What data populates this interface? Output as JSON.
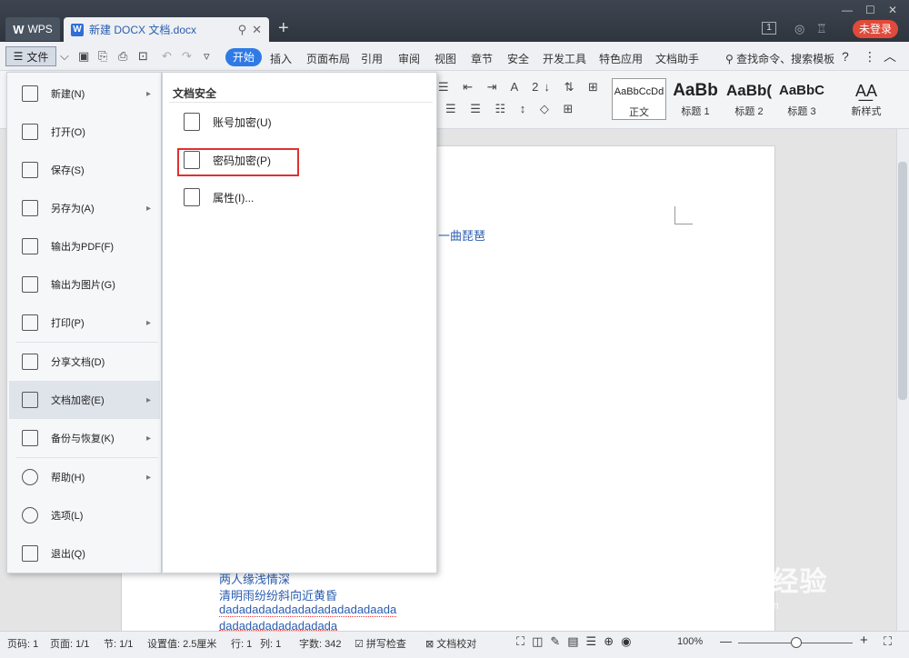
{
  "window": {
    "app_tab": "WPS",
    "doc_tab_title": "新建 DOCX 文档.docx",
    "new_tab_symbol": "+",
    "login_label": "未登录",
    "page_badge": "1"
  },
  "menubar": {
    "file_label": "文件",
    "start_label": "开始",
    "items": [
      "插入",
      "页面布局",
      "引用",
      "审阅",
      "视图",
      "章节",
      "安全",
      "开发工具",
      "特色应用",
      "文档助手"
    ],
    "search_label": "查找命令、搜索模板",
    "help_symbol": "?"
  },
  "ribbon": {
    "styles": [
      {
        "sample": "AaBbCcDd",
        "label": "正文"
      },
      {
        "sample": "AaBb",
        "label": "标题 1"
      },
      {
        "sample": "AaBb(",
        "label": "标题 2"
      },
      {
        "sample": "AaBbC",
        "label": "标题 3"
      }
    ],
    "new_style_label": "新样式"
  },
  "file_menu": {
    "items": [
      {
        "label": "新建(N)",
        "icon": "new-doc-icon",
        "submenu": true
      },
      {
        "label": "打开(O)",
        "icon": "folder-open-icon",
        "submenu": false
      },
      {
        "label": "保存(S)",
        "icon": "save-icon",
        "submenu": false
      },
      {
        "label": "另存为(A)",
        "icon": "save-as-icon",
        "submenu": true
      },
      {
        "label": "输出为PDF(F)",
        "icon": "pdf-icon",
        "submenu": false
      },
      {
        "label": "输出为图片(G)",
        "icon": "image-icon",
        "submenu": false
      },
      {
        "label": "打印(P)",
        "icon": "print-icon",
        "submenu": true
      },
      {
        "label": "分享文档(D)",
        "icon": "share-icon",
        "submenu": false
      },
      {
        "label": "文档加密(E)",
        "icon": "encrypt-doc-icon",
        "submenu": true
      },
      {
        "label": "备份与恢复(K)",
        "icon": "backup-icon",
        "submenu": true
      },
      {
        "label": "帮助(H)",
        "icon": "help-icon",
        "submenu": true
      },
      {
        "label": "选项(L)",
        "icon": "gear-icon",
        "submenu": false
      },
      {
        "label": "退出(Q)",
        "icon": "exit-icon",
        "submenu": false
      }
    ],
    "active_item": "文档加密(E)"
  },
  "security_submenu": {
    "title": "文档安全",
    "items": [
      {
        "label": "账号加密(U)",
        "icon": "account-lock-icon"
      },
      {
        "label": "密码加密(P)",
        "icon": "password-lock-icon"
      },
      {
        "label": "属性(I)...",
        "icon": "properties-icon"
      }
    ],
    "highlighted": "密码加密(P)"
  },
  "document": {
    "fragment": "一曲琵琶",
    "lines": [
      "两人缘浅情深",
      "清明雨纷纷斜向近黄昏",
      "dadadadadadadadadadadadaada",
      "dadadadadadadadada"
    ]
  },
  "statusbar": {
    "page_no": "页码: 1",
    "pages": "页面: 1/1",
    "section": "节: 1/1",
    "setting": "设置值: 2.5厘米",
    "row": "行: 1",
    "col": "列: 1",
    "word_count": "字数: 342",
    "spell_check": "拼写检查",
    "proofread": "文档校对",
    "zoom": "100%"
  },
  "watermark": {
    "brand": "Baidu经验",
    "url": "jingyan.baidu.com"
  },
  "colors": {
    "accent": "#2f7ae5",
    "login": "#e04a3a",
    "highlight_box": "#e03030",
    "doc_text": "#2a5db0"
  }
}
